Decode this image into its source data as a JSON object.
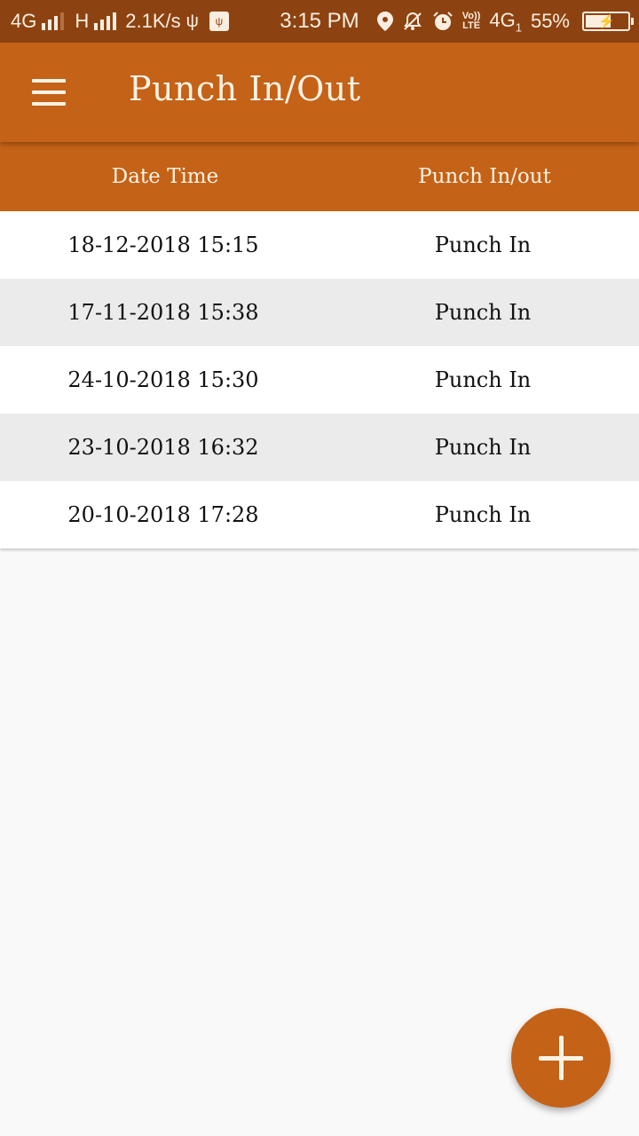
{
  "status_bar": {
    "network1": "4G",
    "network2": "H",
    "speed": "2.1K/s",
    "time": "3:15 PM",
    "volte_top": "Vo))",
    "volte_bottom": "LTE",
    "network3": "4G",
    "network3_sub": "1",
    "battery": "55%",
    "icons": [
      "signal-icon",
      "usb-icon",
      "usb-debug-icon",
      "location-icon",
      "notifications-off-icon",
      "alarm-icon",
      "volte-icon",
      "battery-charging-icon"
    ]
  },
  "app_bar": {
    "title": "Punch In/Out",
    "menu_icon": "hamburger-menu-icon"
  },
  "table": {
    "columns": [
      "Date Time",
      "Punch In/out"
    ],
    "rows": [
      {
        "datetime": "18-12-2018 15:15",
        "type": "Punch In"
      },
      {
        "datetime": "17-11-2018 15:38",
        "type": "Punch In"
      },
      {
        "datetime": "24-10-2018 15:30",
        "type": "Punch In"
      },
      {
        "datetime": "23-10-2018 16:32",
        "type": "Punch In"
      },
      {
        "datetime": "20-10-2018 17:28",
        "type": "Punch In"
      }
    ]
  },
  "fab": {
    "icon": "plus-icon",
    "action": "add-punch"
  },
  "colors": {
    "primary": "#c46218",
    "status_bar": "#8d4311",
    "on_primary": "#fdf3e4",
    "row_alt": "#ebebeb",
    "background": "#f9f9f9"
  }
}
